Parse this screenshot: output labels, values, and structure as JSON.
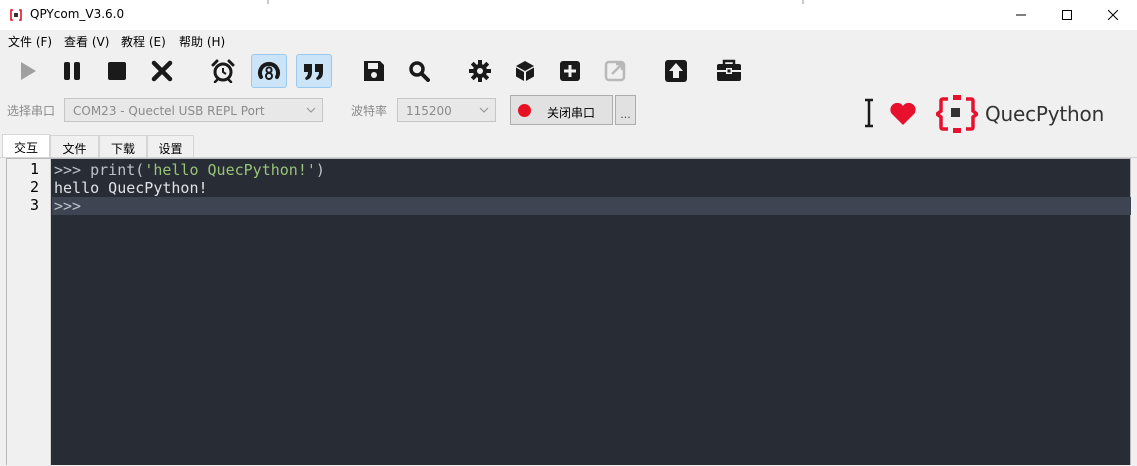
{
  "window": {
    "title": "QPYcom_V3.6.0"
  },
  "menu": [
    {
      "label": "文件 (F)"
    },
    {
      "label": "查看 (V)"
    },
    {
      "label": "教程 (E)"
    },
    {
      "label": "帮助 (H)"
    }
  ],
  "toolbar": {
    "buttons": [
      {
        "icon": "play-icon",
        "enabled": false
      },
      {
        "icon": "pause-icon"
      },
      {
        "icon": "stop-icon"
      },
      {
        "icon": "close-x-icon"
      },
      {
        "icon": "alarm-clock-icon"
      },
      {
        "icon": "ring-8-icon",
        "active": true
      },
      {
        "icon": "quote-icon",
        "active": true
      },
      {
        "icon": "save-disk-icon"
      },
      {
        "icon": "search-icon"
      },
      {
        "icon": "gear-icon"
      },
      {
        "icon": "package-cube-icon"
      },
      {
        "icon": "plus-box-icon"
      },
      {
        "icon": "external-link-icon",
        "enabled": false
      },
      {
        "icon": "upload-arrow-icon"
      },
      {
        "icon": "toolbox-icon"
      }
    ]
  },
  "port": {
    "select_label": "选择串口",
    "port_value": "COM23 - Quectel USB REPL Port",
    "baud_label": "波特率",
    "baud_value": "115200",
    "open_button": "关闭串口",
    "more_button": "..."
  },
  "brand": {
    "name": "QuecPython",
    "accent": "#e8112d"
  },
  "tabs": [
    {
      "label": "交互",
      "active": true
    },
    {
      "label": "文件"
    },
    {
      "label": "下载"
    },
    {
      "label": "设置"
    }
  ],
  "console": {
    "line_numbers": [
      "1",
      "2",
      "3"
    ],
    "line1_prompt": ">>> ",
    "line1_call": "print(",
    "line1_string": "'hello QuecPython!'",
    "line1_close": ")",
    "line2_output": "hello QuecPython!",
    "line3_prompt": ">>>"
  }
}
